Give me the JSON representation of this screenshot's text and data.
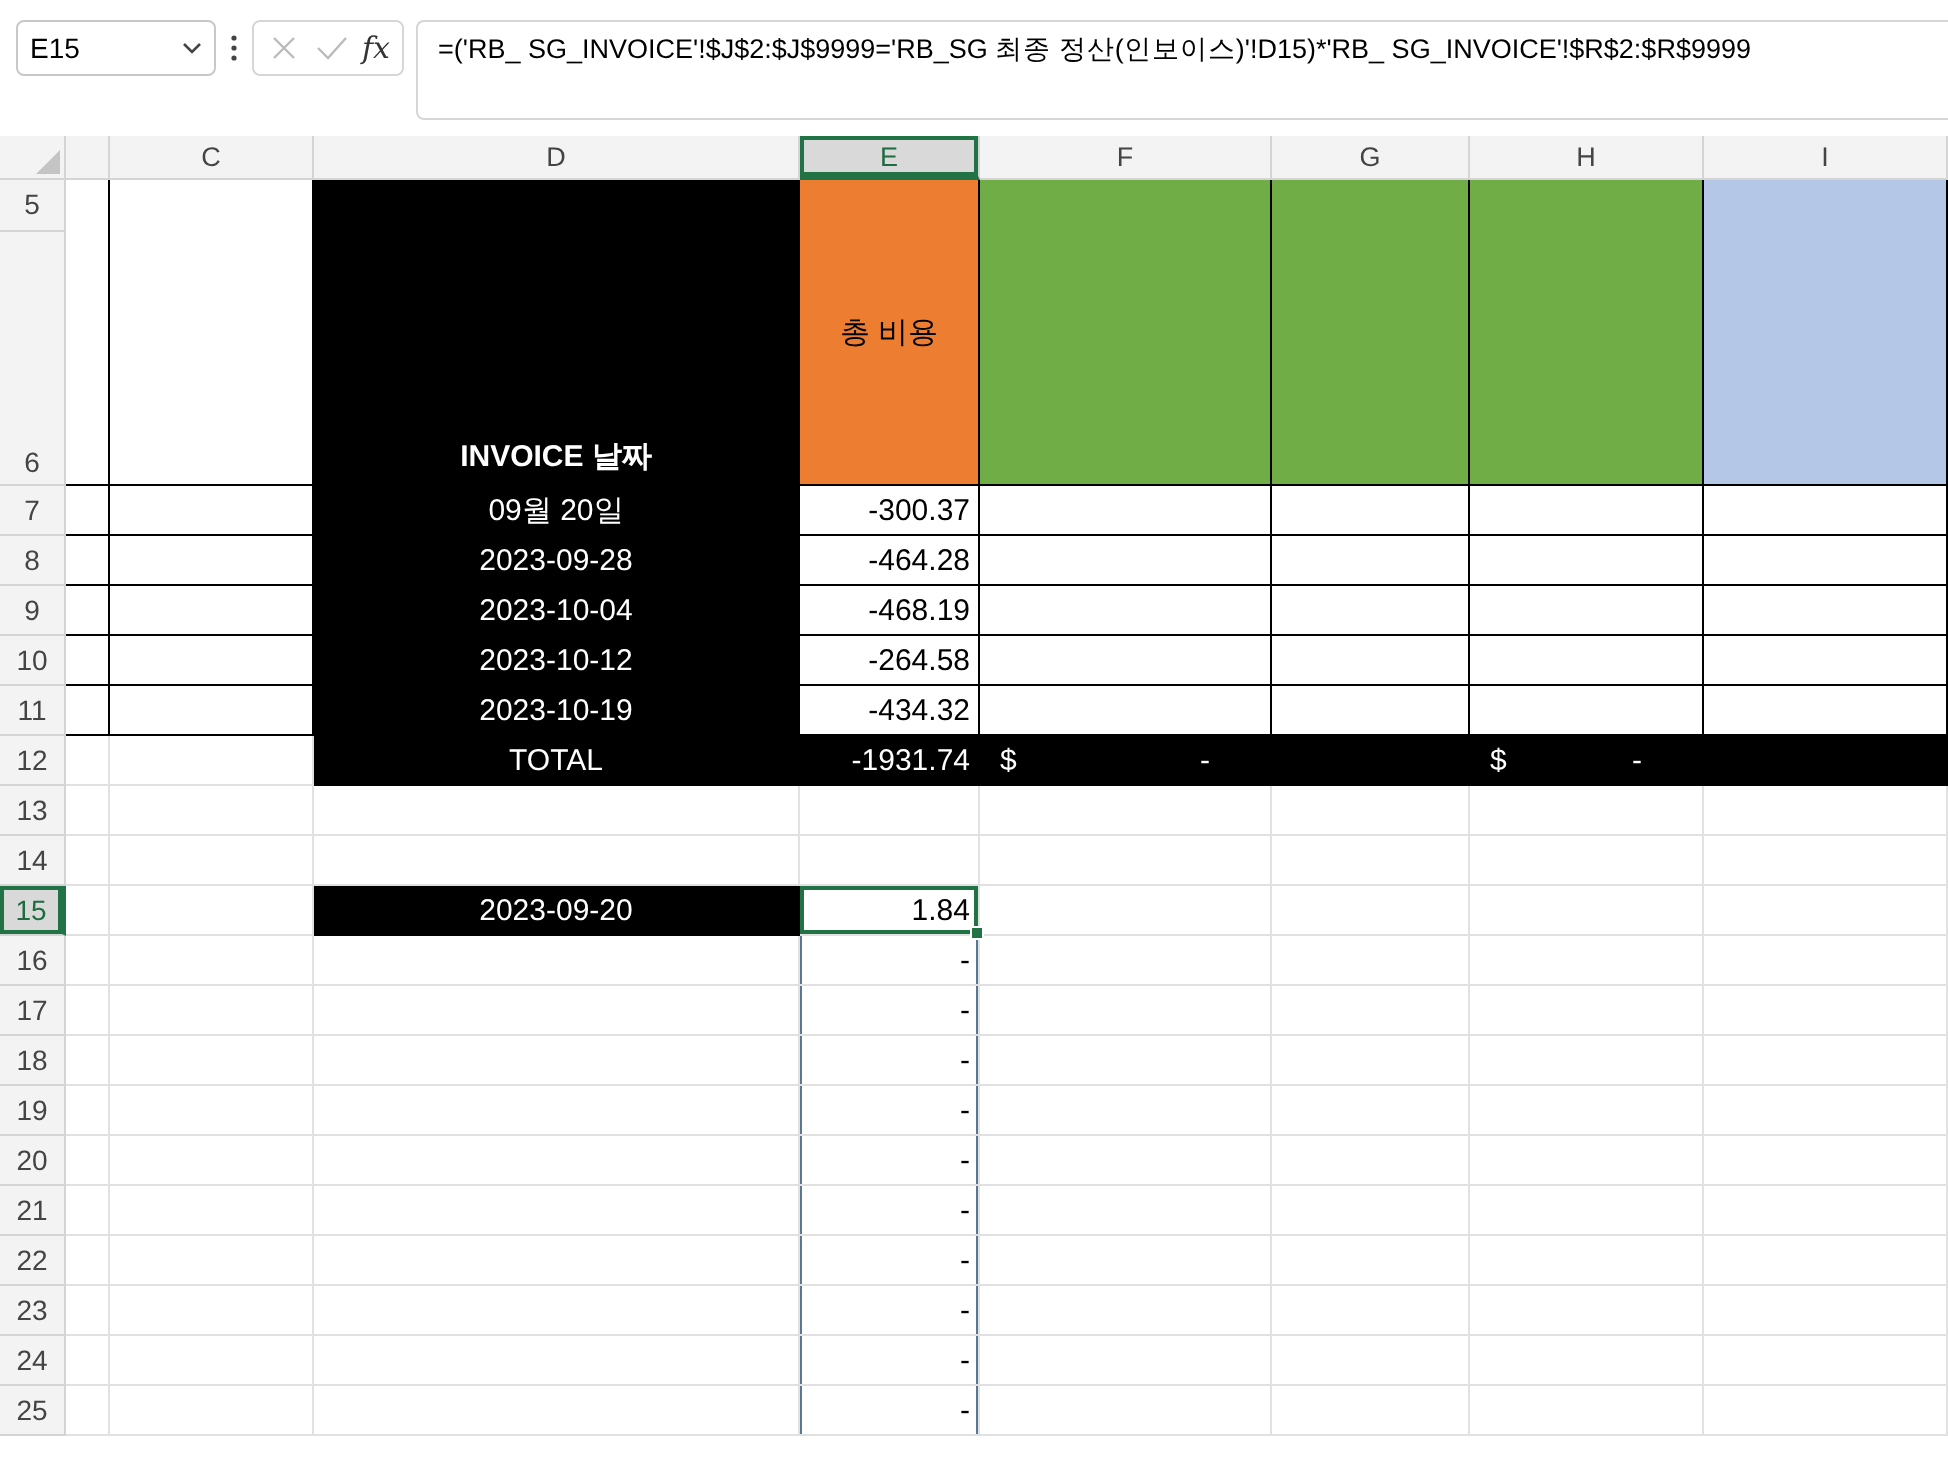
{
  "name_box": {
    "value": "E15"
  },
  "formula_buttons": [
    {
      "kind": "cancel",
      "disabled": true
    },
    {
      "kind": "enter",
      "disabled": true
    },
    {
      "kind": "function",
      "label": "fx",
      "disabled": false
    }
  ],
  "formula_bar": {
    "formula": "=('RB_ SG_INVOICE'!$J$2:$J$9999='RB_SG 최종 정산(인보이스)'!D15)*'RB_ SG_INVOICE'!$R$2:$R$9999"
  },
  "columns": [
    {
      "selected": false
    },
    {
      "label": "C",
      "selected": false
    },
    {
      "label": "D",
      "selected": false
    },
    {
      "label": "E",
      "selected": true
    },
    {
      "label": "F",
      "selected": false
    },
    {
      "label": "G",
      "selected": false
    },
    {
      "label": "H",
      "selected": false
    },
    {
      "label": "I",
      "selected": false
    }
  ],
  "header": {
    "row_numbers": [
      {
        "label": "5",
        "selected": false
      },
      {
        "label": "6",
        "selected": false
      }
    ],
    "cells": [
      {
        "kind": "boxed",
        "selected": false,
        "in_range": false
      },
      {
        "kind": "boxed",
        "selected": false,
        "in_range": false
      },
      {
        "kind": "title",
        "text": "INVOICE 날짜",
        "selected": false,
        "in_range": false
      },
      {
        "kind": "orange",
        "text": "총 비용",
        "selected": false,
        "in_range": false
      },
      {
        "kind": "green",
        "selected": false,
        "in_range": false
      },
      {
        "kind": "green",
        "selected": false,
        "in_range": false
      },
      {
        "kind": "green",
        "selected": false,
        "in_range": false
      },
      {
        "kind": "blue",
        "selected": false,
        "in_range": false
      }
    ]
  },
  "rows": [
    {
      "number": "7",
      "selected": false,
      "cells": [
        {
          "kind": "boxed",
          "selected": false,
          "in_range": false
        },
        {
          "kind": "boxed",
          "selected": false,
          "in_range": false
        },
        {
          "kind": "dark",
          "text": "09월 20일",
          "selected": false,
          "in_range": false
        },
        {
          "kind": "boxed",
          "text": "-300.37",
          "selected": false,
          "in_range": false
        },
        {
          "kind": "boxed",
          "selected": false,
          "in_range": false
        },
        {
          "kind": "boxed",
          "selected": false,
          "in_range": false
        },
        {
          "kind": "boxed",
          "selected": false,
          "in_range": false
        },
        {
          "kind": "boxed",
          "selected": false,
          "in_range": false
        }
      ]
    },
    {
      "number": "8",
      "selected": false,
      "cells": [
        {
          "kind": "boxed",
          "selected": false,
          "in_range": false
        },
        {
          "kind": "boxed",
          "selected": false,
          "in_range": false
        },
        {
          "kind": "dark",
          "text": "2023-09-28",
          "selected": false,
          "in_range": false
        },
        {
          "kind": "boxed",
          "text": "-464.28",
          "selected": false,
          "in_range": false
        },
        {
          "kind": "boxed",
          "selected": false,
          "in_range": false
        },
        {
          "kind": "boxed",
          "selected": false,
          "in_range": false
        },
        {
          "kind": "boxed",
          "selected": false,
          "in_range": false
        },
        {
          "kind": "boxed",
          "selected": false,
          "in_range": false
        }
      ]
    },
    {
      "number": "9",
      "selected": false,
      "cells": [
        {
          "kind": "boxed",
          "selected": false,
          "in_range": false
        },
        {
          "kind": "boxed",
          "selected": false,
          "in_range": false
        },
        {
          "kind": "dark",
          "text": "2023-10-04",
          "selected": false,
          "in_range": false
        },
        {
          "kind": "boxed",
          "text": "-468.19",
          "selected": false,
          "in_range": false
        },
        {
          "kind": "boxed",
          "selected": false,
          "in_range": false
        },
        {
          "kind": "boxed",
          "selected": false,
          "in_range": false
        },
        {
          "kind": "boxed",
          "selected": false,
          "in_range": false
        },
        {
          "kind": "boxed",
          "selected": false,
          "in_range": false
        }
      ]
    },
    {
      "number": "10",
      "selected": false,
      "cells": [
        {
          "kind": "boxed",
          "selected": false,
          "in_range": false
        },
        {
          "kind": "boxed",
          "selected": false,
          "in_range": false
        },
        {
          "kind": "dark",
          "text": "2023-10-12",
          "selected": false,
          "in_range": false
        },
        {
          "kind": "boxed",
          "text": "-264.58",
          "selected": false,
          "in_range": false
        },
        {
          "kind": "boxed",
          "selected": false,
          "in_range": false
        },
        {
          "kind": "boxed",
          "selected": false,
          "in_range": false
        },
        {
          "kind": "boxed",
          "selected": false,
          "in_range": false
        },
        {
          "kind": "boxed",
          "selected": false,
          "in_range": false
        }
      ]
    },
    {
      "number": "11",
      "selected": false,
      "cells": [
        {
          "kind": "boxed",
          "selected": false,
          "in_range": false
        },
        {
          "kind": "boxed",
          "selected": false,
          "in_range": false
        },
        {
          "kind": "dark",
          "text": "2023-10-19",
          "selected": false,
          "in_range": false
        },
        {
          "kind": "boxed",
          "text": "-434.32",
          "selected": false,
          "in_range": false
        },
        {
          "kind": "boxed",
          "selected": false,
          "in_range": false
        },
        {
          "kind": "boxed",
          "selected": false,
          "in_range": false
        },
        {
          "kind": "boxed",
          "selected": false,
          "in_range": false
        },
        {
          "kind": "boxed",
          "selected": false,
          "in_range": false
        }
      ]
    },
    {
      "number": "12",
      "selected": false,
      "cells": [
        {
          "kind": "plain",
          "selected": false,
          "in_range": false
        },
        {
          "kind": "plain",
          "selected": false,
          "in_range": false
        },
        {
          "kind": "dark",
          "text": "TOTAL",
          "selected": false,
          "in_range": false
        },
        {
          "kind": "dark",
          "text": "-1931.74",
          "selected": false,
          "in_range": false
        },
        {
          "kind": "dark",
          "currency": "$",
          "text": "-",
          "selected": false,
          "in_range": false
        },
        {
          "kind": "dark",
          "selected": false,
          "in_range": false
        },
        {
          "kind": "dark",
          "currency": "$",
          "text": "-",
          "selected": false,
          "in_range": false
        },
        {
          "kind": "dark",
          "selected": false,
          "in_range": false
        }
      ]
    },
    {
      "number": "13",
      "selected": false,
      "cells": [
        {
          "kind": "plain",
          "selected": false,
          "in_range": false
        },
        {
          "kind": "plain",
          "selected": false,
          "in_range": false
        },
        {
          "kind": "plain",
          "selected": false,
          "in_range": false
        },
        {
          "kind": "plain",
          "selected": false,
          "in_range": false
        },
        {
          "kind": "plain",
          "selected": false,
          "in_range": false
        },
        {
          "kind": "plain",
          "selected": false,
          "in_range": false
        },
        {
          "kind": "plain",
          "selected": false,
          "in_range": false
        },
        {
          "kind": "plain",
          "selected": false,
          "in_range": false
        }
      ]
    },
    {
      "number": "14",
      "selected": false,
      "cells": [
        {
          "kind": "plain",
          "selected": false,
          "in_range": false
        },
        {
          "kind": "plain",
          "selected": false,
          "in_range": false
        },
        {
          "kind": "plain",
          "selected": false,
          "in_range": false
        },
        {
          "kind": "plain",
          "selected": false,
          "in_range": false
        },
        {
          "kind": "plain",
          "selected": false,
          "in_range": false
        },
        {
          "kind": "plain",
          "selected": false,
          "in_range": false
        },
        {
          "kind": "plain",
          "selected": false,
          "in_range": false
        },
        {
          "kind": "plain",
          "selected": false,
          "in_range": false
        }
      ]
    },
    {
      "number": "15",
      "selected": true,
      "cells": [
        {
          "kind": "plain",
          "selected": false,
          "in_range": false
        },
        {
          "kind": "plain",
          "selected": false,
          "in_range": false
        },
        {
          "kind": "dark",
          "text": "2023-09-20",
          "selected": false,
          "in_range": false
        },
        {
          "kind": "plain",
          "text": "1.84",
          "selected": true,
          "in_range": true
        },
        {
          "kind": "plain",
          "selected": false,
          "in_range": false
        },
        {
          "kind": "plain",
          "selected": false,
          "in_range": false
        },
        {
          "kind": "plain",
          "selected": false,
          "in_range": false
        },
        {
          "kind": "plain",
          "selected": false,
          "in_range": false
        }
      ]
    },
    {
      "number": "16",
      "selected": false,
      "cells": [
        {
          "kind": "plain",
          "selected": false,
          "in_range": false
        },
        {
          "kind": "plain",
          "selected": false,
          "in_range": false
        },
        {
          "kind": "plain",
          "selected": false,
          "in_range": false
        },
        {
          "kind": "plain",
          "text": "-",
          "selected": false,
          "in_range": true
        },
        {
          "kind": "plain",
          "selected": false,
          "in_range": false
        },
        {
          "kind": "plain",
          "selected": false,
          "in_range": false
        },
        {
          "kind": "plain",
          "selected": false,
          "in_range": false
        },
        {
          "kind": "plain",
          "selected": false,
          "in_range": false
        }
      ]
    },
    {
      "number": "17",
      "selected": false,
      "cells": [
        {
          "kind": "plain",
          "selected": false,
          "in_range": false
        },
        {
          "kind": "plain",
          "selected": false,
          "in_range": false
        },
        {
          "kind": "plain",
          "selected": false,
          "in_range": false
        },
        {
          "kind": "plain",
          "text": "-",
          "selected": false,
          "in_range": true
        },
        {
          "kind": "plain",
          "selected": false,
          "in_range": false
        },
        {
          "kind": "plain",
          "selected": false,
          "in_range": false
        },
        {
          "kind": "plain",
          "selected": false,
          "in_range": false
        },
        {
          "kind": "plain",
          "selected": false,
          "in_range": false
        }
      ]
    },
    {
      "number": "18",
      "selected": false,
      "cells": [
        {
          "kind": "plain",
          "selected": false,
          "in_range": false
        },
        {
          "kind": "plain",
          "selected": false,
          "in_range": false
        },
        {
          "kind": "plain",
          "selected": false,
          "in_range": false
        },
        {
          "kind": "plain",
          "text": "-",
          "selected": false,
          "in_range": true
        },
        {
          "kind": "plain",
          "selected": false,
          "in_range": false
        },
        {
          "kind": "plain",
          "selected": false,
          "in_range": false
        },
        {
          "kind": "plain",
          "selected": false,
          "in_range": false
        },
        {
          "kind": "plain",
          "selected": false,
          "in_range": false
        }
      ]
    },
    {
      "number": "19",
      "selected": false,
      "cells": [
        {
          "kind": "plain",
          "selected": false,
          "in_range": false
        },
        {
          "kind": "plain",
          "selected": false,
          "in_range": false
        },
        {
          "kind": "plain",
          "selected": false,
          "in_range": false
        },
        {
          "kind": "plain",
          "text": "-",
          "selected": false,
          "in_range": true
        },
        {
          "kind": "plain",
          "selected": false,
          "in_range": false
        },
        {
          "kind": "plain",
          "selected": false,
          "in_range": false
        },
        {
          "kind": "plain",
          "selected": false,
          "in_range": false
        },
        {
          "kind": "plain",
          "selected": false,
          "in_range": false
        }
      ]
    },
    {
      "number": "20",
      "selected": false,
      "cells": [
        {
          "kind": "plain",
          "selected": false,
          "in_range": false
        },
        {
          "kind": "plain",
          "selected": false,
          "in_range": false
        },
        {
          "kind": "plain",
          "selected": false,
          "in_range": false
        },
        {
          "kind": "plain",
          "text": "-",
          "selected": false,
          "in_range": true
        },
        {
          "kind": "plain",
          "selected": false,
          "in_range": false
        },
        {
          "kind": "plain",
          "selected": false,
          "in_range": false
        },
        {
          "kind": "plain",
          "selected": false,
          "in_range": false
        },
        {
          "kind": "plain",
          "selected": false,
          "in_range": false
        }
      ]
    },
    {
      "number": "21",
      "selected": false,
      "cells": [
        {
          "kind": "plain",
          "selected": false,
          "in_range": false
        },
        {
          "kind": "plain",
          "selected": false,
          "in_range": false
        },
        {
          "kind": "plain",
          "selected": false,
          "in_range": false
        },
        {
          "kind": "plain",
          "text": "-",
          "selected": false,
          "in_range": true
        },
        {
          "kind": "plain",
          "selected": false,
          "in_range": false
        },
        {
          "kind": "plain",
          "selected": false,
          "in_range": false
        },
        {
          "kind": "plain",
          "selected": false,
          "in_range": false
        },
        {
          "kind": "plain",
          "selected": false,
          "in_range": false
        }
      ]
    },
    {
      "number": "22",
      "selected": false,
      "cells": [
        {
          "kind": "plain",
          "selected": false,
          "in_range": false
        },
        {
          "kind": "plain",
          "selected": false,
          "in_range": false
        },
        {
          "kind": "plain",
          "selected": false,
          "in_range": false
        },
        {
          "kind": "plain",
          "text": "-",
          "selected": false,
          "in_range": true
        },
        {
          "kind": "plain",
          "selected": false,
          "in_range": false
        },
        {
          "kind": "plain",
          "selected": false,
          "in_range": false
        },
        {
          "kind": "plain",
          "selected": false,
          "in_range": false
        },
        {
          "kind": "plain",
          "selected": false,
          "in_range": false
        }
      ]
    },
    {
      "number": "23",
      "selected": false,
      "cells": [
        {
          "kind": "plain",
          "selected": false,
          "in_range": false
        },
        {
          "kind": "plain",
          "selected": false,
          "in_range": false
        },
        {
          "kind": "plain",
          "selected": false,
          "in_range": false
        },
        {
          "kind": "plain",
          "text": "-",
          "selected": false,
          "in_range": true
        },
        {
          "kind": "plain",
          "selected": false,
          "in_range": false
        },
        {
          "kind": "plain",
          "selected": false,
          "in_range": false
        },
        {
          "kind": "plain",
          "selected": false,
          "in_range": false
        },
        {
          "kind": "plain",
          "selected": false,
          "in_range": false
        }
      ]
    },
    {
      "number": "24",
      "selected": false,
      "cells": [
        {
          "kind": "plain",
          "selected": false,
          "in_range": false
        },
        {
          "kind": "plain",
          "selected": false,
          "in_range": false
        },
        {
          "kind": "plain",
          "selected": false,
          "in_range": false
        },
        {
          "kind": "plain",
          "text": "-",
          "selected": false,
          "in_range": true
        },
        {
          "kind": "plain",
          "selected": false,
          "in_range": false
        },
        {
          "kind": "plain",
          "selected": false,
          "in_range": false
        },
        {
          "kind": "plain",
          "selected": false,
          "in_range": false
        },
        {
          "kind": "plain",
          "selected": false,
          "in_range": false
        }
      ]
    },
    {
      "number": "25",
      "selected": false,
      "cells": [
        {
          "kind": "plain",
          "selected": false,
          "in_range": false
        },
        {
          "kind": "plain",
          "selected": false,
          "in_range": false
        },
        {
          "kind": "plain",
          "selected": false,
          "in_range": false
        },
        {
          "kind": "plain",
          "text": "-",
          "selected": false,
          "in_range": true
        },
        {
          "kind": "plain",
          "selected": false,
          "in_range": false
        },
        {
          "kind": "plain",
          "selected": false,
          "in_range": false
        },
        {
          "kind": "plain",
          "selected": false,
          "in_range": false
        },
        {
          "kind": "plain",
          "selected": false,
          "in_range": false
        }
      ]
    }
  ]
}
